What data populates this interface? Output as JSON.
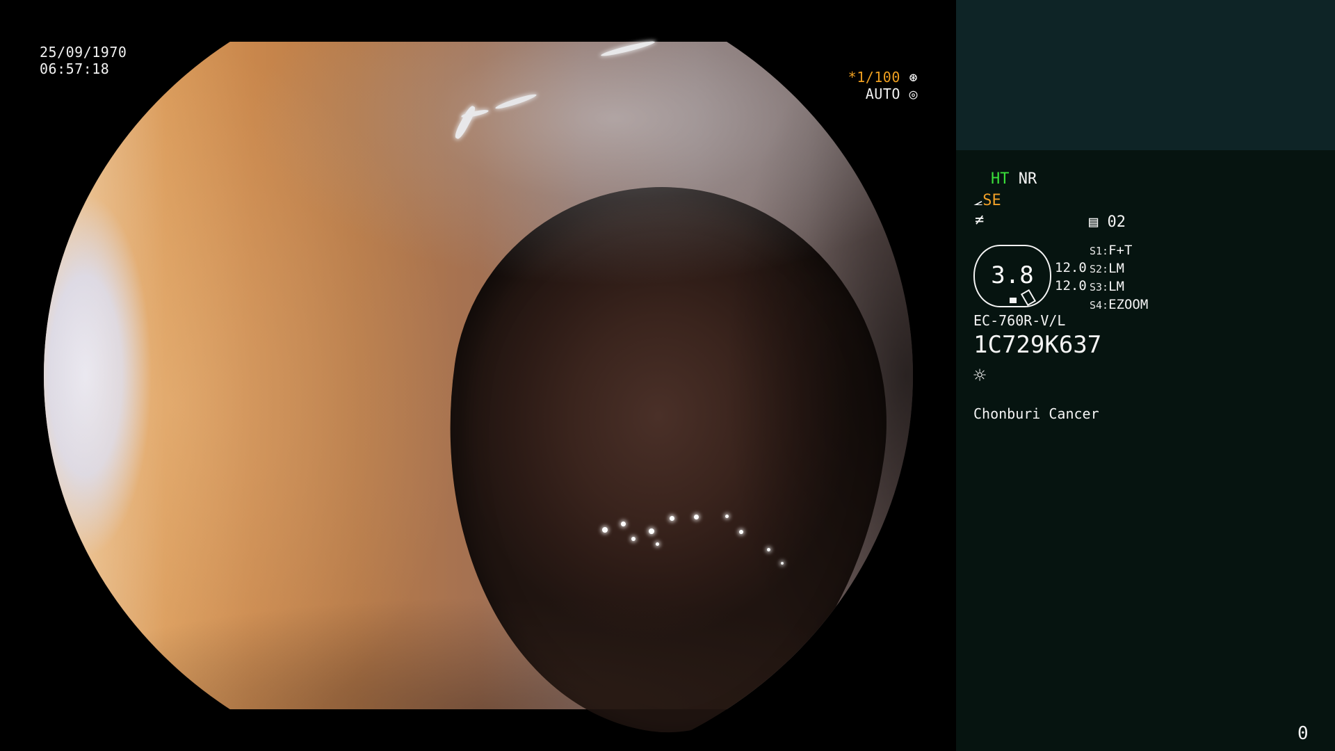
{
  "overlay": {
    "date": "25/09/1970",
    "time": "06:57:18",
    "shutter_prefix": "*",
    "shutter_speed": "1/100",
    "exposure_mode": "AUTO"
  },
  "panel": {
    "ht": "HT",
    "nr": "NR",
    "se": "SE",
    "memory_slot": "02",
    "enhancement_value": "3.8",
    "value_a": "12.0",
    "value_b": "12.0",
    "switches": [
      {
        "key": "S1:",
        "value": "F+T"
      },
      {
        "key": "S2:",
        "value": "LM"
      },
      {
        "key": "S3:",
        "value": "LM"
      },
      {
        "key": "S4:",
        "value": "EZOOM"
      }
    ],
    "scope_model": "EC-760R-V/L",
    "scope_serial": "1C729K637",
    "institution": "Chonburi Cancer",
    "counter": "0"
  },
  "colors": {
    "panel_top": "#0e2426",
    "panel_bg": "#061410",
    "ht_green": "#3adf3a",
    "se_orange": "#f0a028"
  },
  "icons": [
    "shutter-icon",
    "auto-exposure-icon",
    "structure-enhance-icon",
    "noise-icon",
    "memory-icon",
    "light-icon"
  ]
}
